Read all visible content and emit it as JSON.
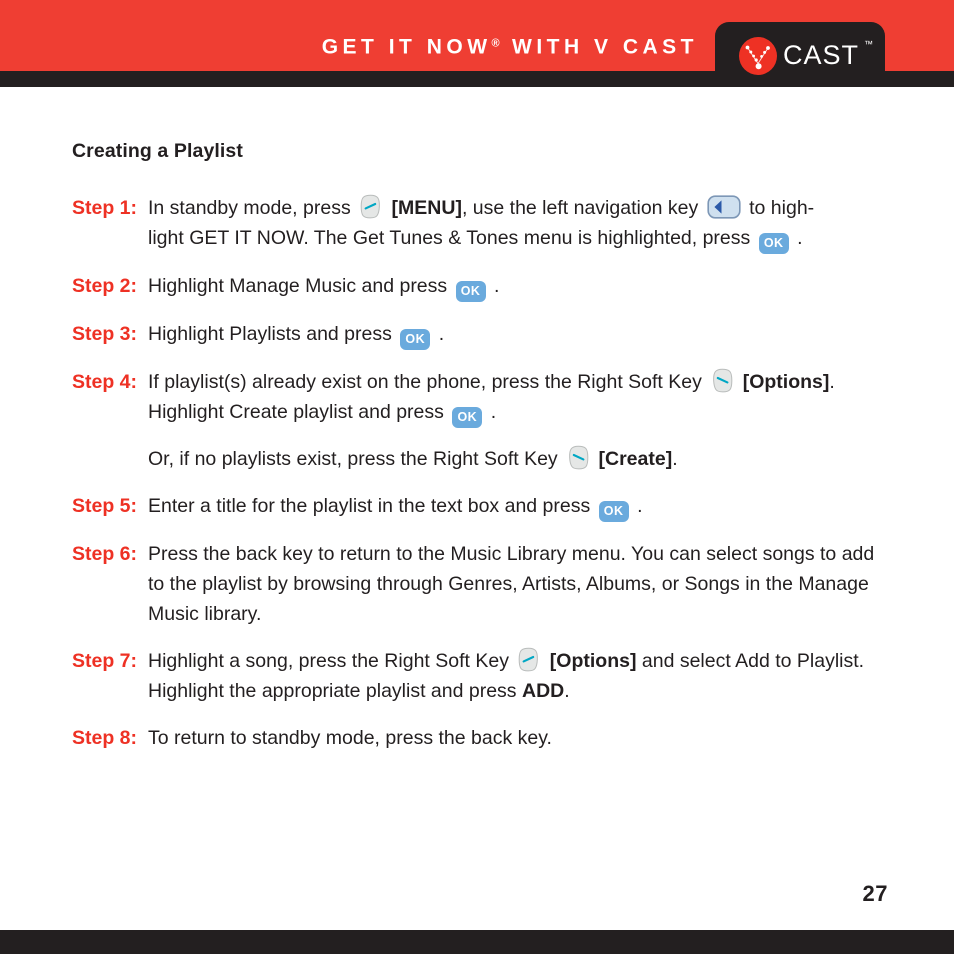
{
  "header": {
    "title_main": "GET IT NOW",
    "title_reg": "®",
    "title_rest": "WITH V CAST",
    "logo_text": "CAST",
    "logo_tm": "™",
    "red": "#ef3e33",
    "dark": "#231f20"
  },
  "page": {
    "section_title": "Creating a Playlist",
    "page_number": "27",
    "accent_red": "#ee3124",
    "key_blue": "#6aaadd",
    "key_grey": "#e3e5e4",
    "key_cyan": "#00a7c4",
    "nav_blue": "#2b59a8"
  },
  "steps": [
    {
      "label": "Step 1:",
      "lines": [
        "In standby mode, press ",
        " [MENU], use the left navigation key ",
        " to highlight GET IT NOW. The Get Tunes & Tones menu is highlighted, press ",
        " ."
      ],
      "text_1": "In standby mode, press",
      "bold_menu": "[MENU]",
      "text_2": ", use the left navigation key",
      "text_3": "to high-",
      "text_4": "light GET IT NOW. The Get Tunes & Tones menu is highlighted, press",
      "text_5": "."
    },
    {
      "label": "Step 2:",
      "text_1": "Highlight Manage Music and press",
      "text_2": "."
    },
    {
      "label": "Step 3:",
      "text_1": "Highlight Playlists and press",
      "text_2": "."
    },
    {
      "label": "Step 4:",
      "text_1": "If playlist(s) already exist on the phone, press the Right Soft Key",
      "bold_options": "[Options]",
      "text_2": ".",
      "text_3": "Highlight Create playlist and press",
      "text_4": ".",
      "text_5": "Or, if no playlists exist, press the Right Soft Key",
      "bold_create": "[Create]",
      "text_6": "."
    },
    {
      "label": "Step 5:",
      "text_1": "Enter a title for the playlist in the text box and press",
      "text_2": "."
    },
    {
      "label": "Step 6:",
      "text_1": "Press the back key to return to the Music Library menu. You can select songs to add to the playlist by browsing through Genres, Artists, Albums, or Songs in the Manage Music library."
    },
    {
      "label": "Step 7:",
      "text_1": "Highlight a song, press the Right Soft Key",
      "bold_options": "[Options]",
      "text_2": "and select Add to Playlist. Highlight the appropriate playlist and press",
      "bold_add": "ADD",
      "text_3": "."
    },
    {
      "label": "Step 8:",
      "text_1": "To return to standby mode, press the back key."
    }
  ],
  "icons": {
    "softkey_left": "left-soft-key-icon",
    "softkey_right": "right-soft-key-icon",
    "ok": "OK",
    "nav_left": "left-navigation-key-icon"
  }
}
